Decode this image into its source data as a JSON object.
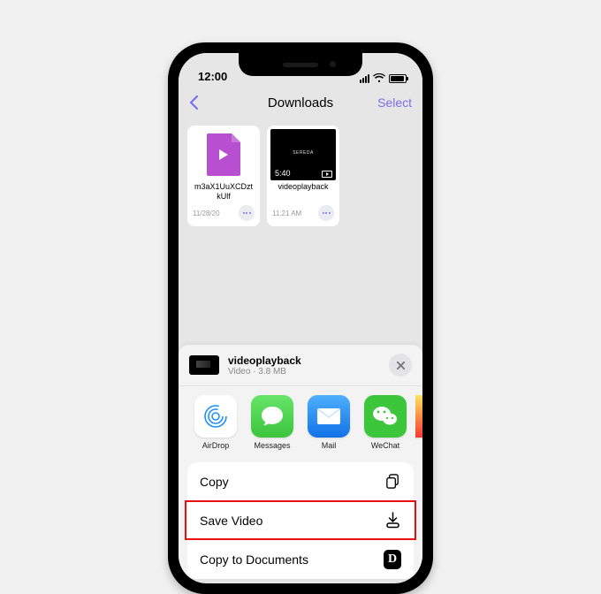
{
  "status": {
    "time": "12:00"
  },
  "nav": {
    "title": "Downloads",
    "select": "Select"
  },
  "files": [
    {
      "name": "m3aX1UuXCDztkUlf",
      "date": "11/28/20",
      "kind": "doc"
    },
    {
      "name": "videoplayback",
      "date": "11:21 AM",
      "kind": "video",
      "duration": "5:40"
    }
  ],
  "sheet": {
    "name": "videoplayback",
    "meta": "Video · 3.8 MB"
  },
  "apps": [
    {
      "label": "AirDrop"
    },
    {
      "label": "Messages"
    },
    {
      "label": "Mail"
    },
    {
      "label": "WeChat"
    }
  ],
  "actions": {
    "copy": "Copy",
    "save_video": "Save Video",
    "copy_to_documents": "Copy to Documents"
  }
}
